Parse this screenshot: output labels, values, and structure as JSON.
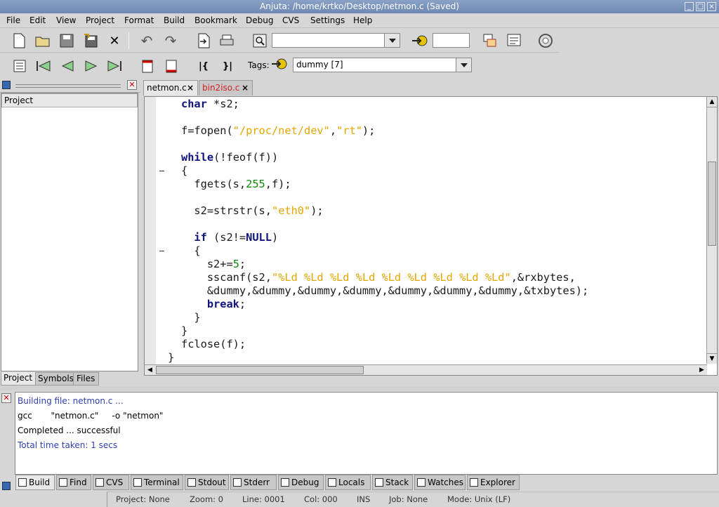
{
  "window": {
    "title": "Anjuta: /home/krtko/Desktop/netmon.c (Saved)"
  },
  "menu": [
    "File",
    "Edit",
    "View",
    "Project",
    "Format",
    "Build",
    "Bookmark",
    "Debug",
    "CVS",
    "Settings",
    "Help"
  ],
  "toolbar2": {
    "tags_label": "Tags:",
    "tags_value": "dummy [7]"
  },
  "editor_tabs": [
    {
      "label": "netmon.c"
    },
    {
      "label": "bin2iso.c"
    }
  ],
  "left_panel": {
    "header": "Project",
    "tabs": [
      "Project",
      "Symbols",
      "Files"
    ]
  },
  "code_lines": [
    [
      {
        "t": "char",
        "c": "kw"
      },
      {
        "t": " *s2;",
        "c": ""
      }
    ],
    [],
    [
      {
        "t": "f=fopen(",
        "c": ""
      },
      {
        "t": "\"/proc/net/dev\"",
        "c": "str"
      },
      {
        "t": ",",
        "c": ""
      },
      {
        "t": "\"rt\"",
        "c": "str"
      },
      {
        "t": ");",
        "c": ""
      }
    ],
    [],
    [
      {
        "t": "while",
        "c": "kw"
      },
      {
        "t": "(!feof(f))",
        "c": ""
      }
    ],
    [
      {
        "t": "{",
        "c": ""
      }
    ],
    [
      {
        "t": "  fgets(s,",
        "c": ""
      },
      {
        "t": "255",
        "c": "num"
      },
      {
        "t": ",f);",
        "c": ""
      }
    ],
    [],
    [
      {
        "t": "  s2=strstr(s,",
        "c": ""
      },
      {
        "t": "\"eth0\"",
        "c": "str"
      },
      {
        "t": ");",
        "c": ""
      }
    ],
    [],
    [
      {
        "t": "  ",
        "c": ""
      },
      {
        "t": "if",
        "c": "kw"
      },
      {
        "t": " (s2!=",
        "c": ""
      },
      {
        "t": "NULL",
        "c": "kw"
      },
      {
        "t": ")",
        "c": ""
      }
    ],
    [
      {
        "t": "  {",
        "c": ""
      }
    ],
    [
      {
        "t": "    s2+=",
        "c": ""
      },
      {
        "t": "5",
        "c": "num"
      },
      {
        "t": ";",
        "c": ""
      }
    ],
    [
      {
        "t": "    sscanf(s2,",
        "c": ""
      },
      {
        "t": "\"%Ld %Ld %Ld %Ld %Ld %Ld %Ld %Ld %Ld\"",
        "c": "str"
      },
      {
        "t": ",&rxbytes,",
        "c": ""
      }
    ],
    [
      {
        "t": "    &dummy,&dummy,&dummy,&dummy,&dummy,&dummy,&dummy,&txbytes);",
        "c": ""
      }
    ],
    [
      {
        "t": "    ",
        "c": ""
      },
      {
        "t": "break",
        "c": "kw"
      },
      {
        "t": ";",
        "c": ""
      }
    ],
    [
      {
        "t": "  }",
        "c": ""
      }
    ],
    [
      {
        "t": "}",
        "c": ""
      }
    ],
    [
      {
        "t": "fclose(f);",
        "c": ""
      }
    ],
    [
      {
        "t": "}",
        "c": ""
      }
    ]
  ],
  "build_output": [
    {
      "text": "Building file: netmon.c ...",
      "color": "#2f3fb0"
    },
    {
      "text": "gcc       \"netmon.c\"     -o \"netmon\"",
      "color": "#000000"
    },
    {
      "text": "Completed ... successful",
      "color": "#000000"
    },
    {
      "text": "Total time taken: 1 secs",
      "color": "#2f3fb0"
    }
  ],
  "bottom_tabs": [
    "Build",
    "Find",
    "CVS",
    "Terminal",
    "Stdout",
    "Stderr",
    "Debug",
    "Locals",
    "Stack",
    "Watches",
    "Explorer"
  ],
  "status": {
    "project": "Project: None",
    "zoom": "Zoom: 0",
    "line": "Line: 0001",
    "col": "Col: 000",
    "ins": "INS",
    "job": "Job: None",
    "mode": "Mode: Unix (LF)"
  }
}
